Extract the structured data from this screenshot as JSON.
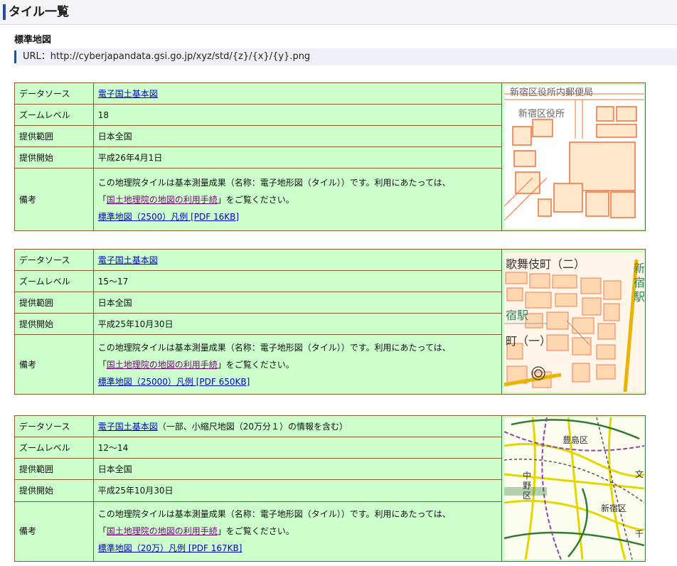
{
  "header": {
    "title": "タイル一覧"
  },
  "section": {
    "title": "標準地図",
    "url": "URL：http://cyberjapandata.gsi.go.jp/xyz/std/{z}/{x}/{y}.png"
  },
  "labels": {
    "source": "データソース",
    "zoom": "ズームレベル",
    "range": "提供範囲",
    "start": "提供開始",
    "notes": "備考"
  },
  "tiles": [
    {
      "source_link": "電子国土基本図",
      "source_extra": "",
      "zoom": "18",
      "range": "日本全国",
      "start": "平成26年4月1日",
      "note_text1": "この地理院タイルは基本測量成果（名称：電子地形図（タイル））です。利用にあたっては、",
      "note_prefix": "「",
      "note_link": "国土地理院の地図の利用手続",
      "note_suffix": "」をご覧ください。",
      "legend_link": "標準地図（2500）凡例 [PDF 16KB]",
      "map_labels": [
        "新宿区役所内郵便局",
        "新宿区役所"
      ]
    },
    {
      "source_link": "電子国土基本図",
      "source_extra": "",
      "zoom": "15～17",
      "range": "日本全国",
      "start": "平成25年10月30日",
      "note_text1": "この地理院タイルは基本測量成果（名称：電子地形図（タイル））です。利用にあたっては、",
      "note_prefix": "「",
      "note_link": "国土地理院の地図の利用手続",
      "note_suffix": "」をご覧ください。",
      "legend_link": "標準地図（25000）凡例 [PDF 650KB]",
      "map_labels": [
        "歌舞伎町（二）",
        "宿駅",
        "町（一）",
        "新",
        "宿",
        "駅"
      ]
    },
    {
      "source_link": "電子国土基本図",
      "source_extra": "（一部、小縮尺地図（20万分１）の情報を含む）",
      "zoom": "12～14",
      "range": "日本全国",
      "start": "平成25年10月30日",
      "note_text1": "この地理院タイルは基本測量成果（名称：電子地形図（タイル））です。利用にあたっては、",
      "note_prefix": "「",
      "note_link": "国土地理院の地図の利用手続",
      "note_suffix": "」をご覧ください。",
      "legend_link": "標準地図（20万）凡例 [PDF 167KB]",
      "map_labels": [
        "豊島区",
        "中",
        "野",
        "区",
        "新宿区",
        "文",
        "千"
      ]
    }
  ],
  "colors": {
    "table_bg": "#ccffcc",
    "border": "#8a5a2a",
    "header_accent": "#2a4d9a",
    "link": "#0000cc",
    "visited_link": "#800080"
  }
}
